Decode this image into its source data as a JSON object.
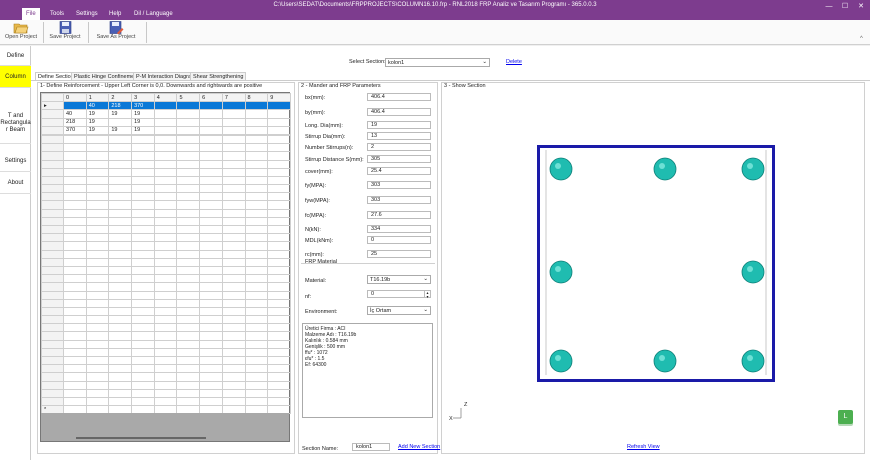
{
  "window": {
    "title": "C:\\Users\\SEDAT\\Documents\\FRPPROJECTS\\COLUMN16.10.frp - RNL2018 FRP Analiz ve Tasarım Programı - 365.0.0.3",
    "minimize": "—",
    "maximize": "☐",
    "close": "✕"
  },
  "menu": {
    "file": "File",
    "tools": "Tools",
    "settings": "Settings",
    "help": "Help",
    "language": "Dil / Language"
  },
  "ribbon": {
    "open": "Open Project",
    "save": "Save Project",
    "save_as": "Save As Project"
  },
  "nav": {
    "define": "Define",
    "column": "Column",
    "tbeam": "T and Rectangula r Beam",
    "settings": "Settings",
    "about": "About"
  },
  "header": {
    "select_section_label": "Select Section:",
    "select_section_value": "kolon1",
    "delete": "Delete"
  },
  "tabs": [
    "Define Section",
    "Plastic Hinge Confinement",
    "P-M Interaction Diagram",
    "Shear Strengthening"
  ],
  "panel1": {
    "title": "1- Define Reinforcement - Upper Left Corner is 0,0. Downwards and rightwards are positive"
  },
  "grid": {
    "headers": [
      "0",
      "1",
      "2",
      "3",
      "4",
      "5",
      "6",
      "7",
      "8",
      "9"
    ],
    "rows": [
      [
        "",
        "40",
        "218",
        "370"
      ],
      [
        "40",
        "19",
        "19",
        "19"
      ],
      [
        "218",
        "19",
        "",
        "19"
      ],
      [
        "370",
        "19",
        "19",
        "19"
      ]
    ],
    "row_marker": "▸",
    "new_row_marker": "*"
  },
  "panel2": {
    "title": "2 - Mander and  FRP Parameters",
    "fields": [
      [
        "bx(mm):",
        "406.4"
      ],
      [
        "by(mm):",
        "406.4"
      ],
      [
        "Long. Dia(mm):",
        "19"
      ],
      [
        "Stirrup Dia(mm):",
        "13"
      ],
      [
        "Number Stirrups(n):",
        "2"
      ],
      [
        "Stirrup Distance S(mm):",
        "305"
      ],
      [
        "cover(mm):",
        "25.4"
      ],
      [
        "fy(MPA):",
        "303"
      ],
      [
        "fyw(MPA):",
        "303"
      ],
      [
        "fc(MPA):",
        "27.6"
      ],
      [
        "N(kN):",
        "334"
      ],
      [
        "MDL(kNm):",
        "0"
      ],
      [
        "rc(mm):",
        "25"
      ]
    ],
    "frp_title": "FRP Material",
    "material_label": "Material:",
    "material_value": "T16.19b",
    "nf_label": "nf:",
    "nf_value": "0",
    "env_label": "Environment:",
    "env_value": "İç Ortam",
    "memo": [
      "Üretici Firma : ACI",
      "Malzeme Adı : T16.19b",
      "Kalınlık : 0.584 mm",
      "Genişlik : 500 mm",
      "ffu* : 1072",
      "εfu* : 1.5",
      "Ef: 64300"
    ]
  },
  "panel3": {
    "title": "3 - Show Section",
    "refresh": "Refresh View",
    "axis_x": "X",
    "axis_z": "Z",
    "l_badge": "L"
  },
  "footer": {
    "section_name_label": "Section Name:",
    "section_name_value": "kolon1",
    "add_new": "Add New Section"
  },
  "colors": {
    "title_bar": "#7d3c8e",
    "selection": "#0a78d7",
    "section_outline": "#1a1aa8",
    "bar": "#1fbcb0",
    "nav_selected": "#ffff00"
  }
}
